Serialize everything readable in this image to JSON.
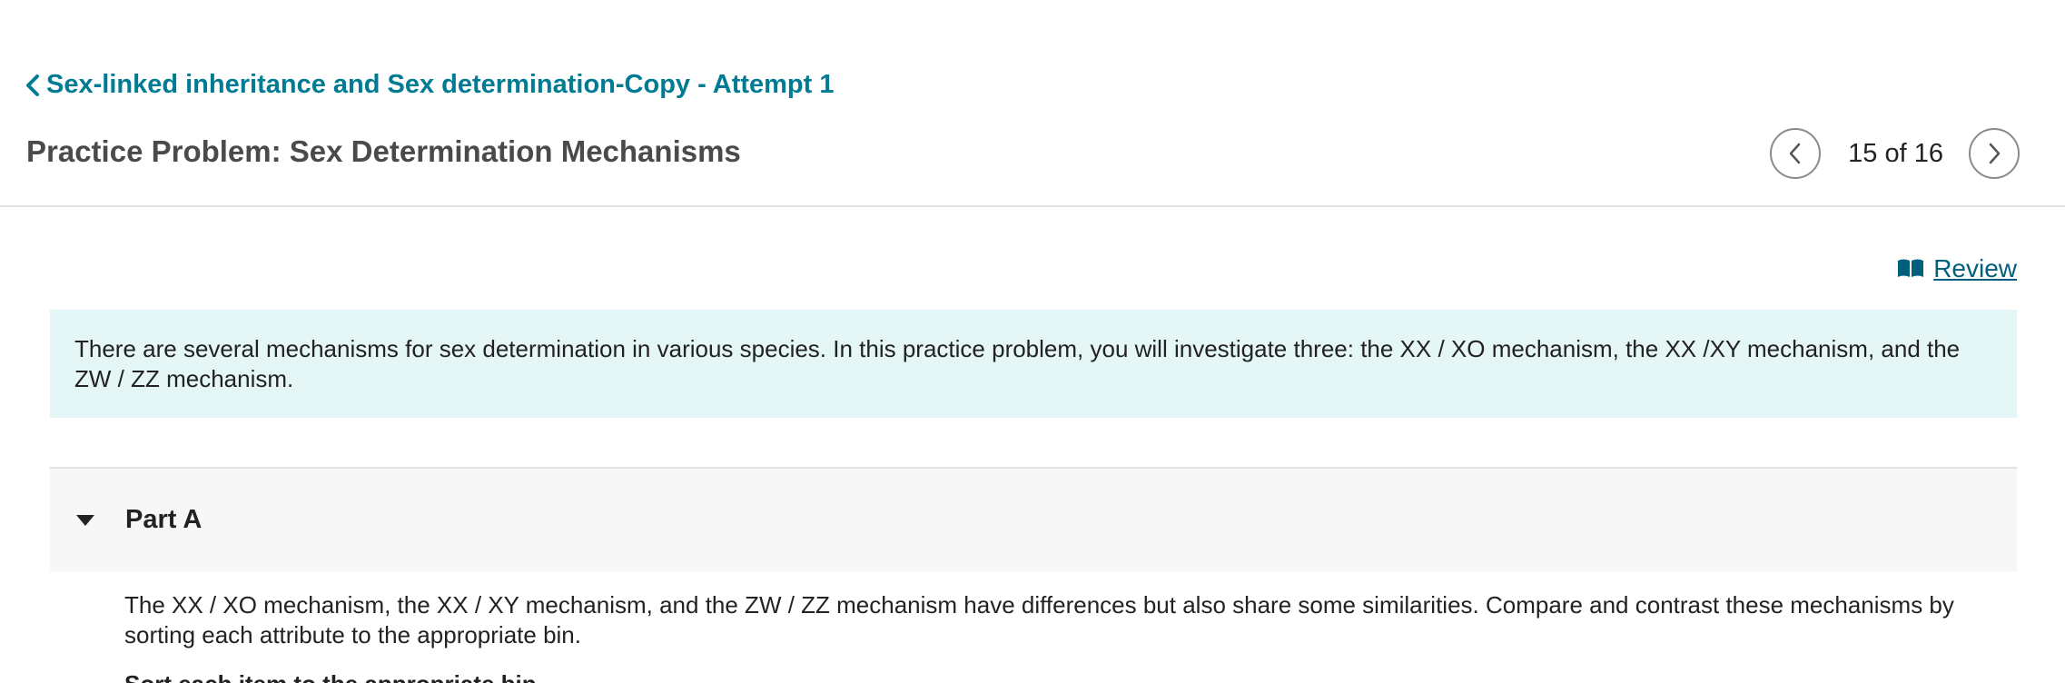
{
  "header": {
    "back_link_label": "Sex-linked inheritance and Sex determination-Copy - Attempt 1",
    "page_title": "Practice Problem: Sex Determination Mechanisms"
  },
  "pager": {
    "counter": "15 of 16",
    "prev_icon": "chevron-left-icon",
    "next_icon": "chevron-right-icon"
  },
  "review": {
    "label": "Review",
    "icon": "open-book-icon"
  },
  "intro": {
    "text": "There are several mechanisms for sex determination in various species. In this practice problem, you will investigate three: the XX / XO mechanism, the XX /XY mechanism, and the ZW / ZZ mechanism."
  },
  "part_a": {
    "title": "Part A",
    "caret_icon": "caret-down-icon",
    "body": "The XX / XO mechanism, the XX / XY mechanism, and the ZW / ZZ mechanism have differences but also share some similarities. Compare and contrast these mechanisms by sorting each attribute to the appropriate bin.",
    "instruction": "Sort each item to the appropriate bin."
  },
  "colors": {
    "link": "#007b93",
    "intro_background": "#e4f6f5",
    "part_background": "#f7f7f7"
  }
}
